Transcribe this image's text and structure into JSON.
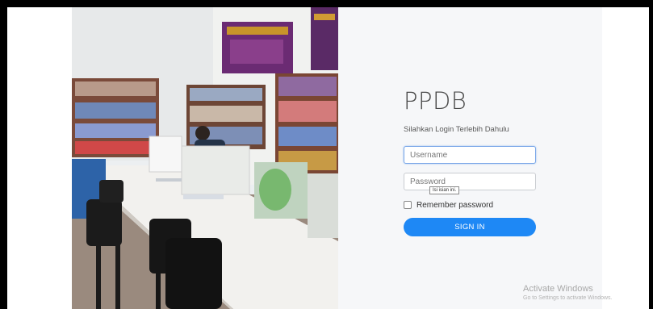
{
  "login": {
    "title": "PPDB",
    "subtitle": "Silahkan Login Terlebih Dahulu",
    "username_placeholder": "Username",
    "password_placeholder": "Password",
    "tooltip": "Isi isian ini.",
    "remember_label": "Remember password",
    "signin_label": "SIGN IN"
  },
  "watermark": {
    "title": "Activate Windows",
    "subtitle": "Go to Settings to activate Windows."
  },
  "colors": {
    "accent": "#1e88f5",
    "focus_border": "#7aa7e8",
    "panel_bg": "#f6f7f9"
  },
  "photo": {
    "description_icon": "library-reading-room-photo"
  }
}
